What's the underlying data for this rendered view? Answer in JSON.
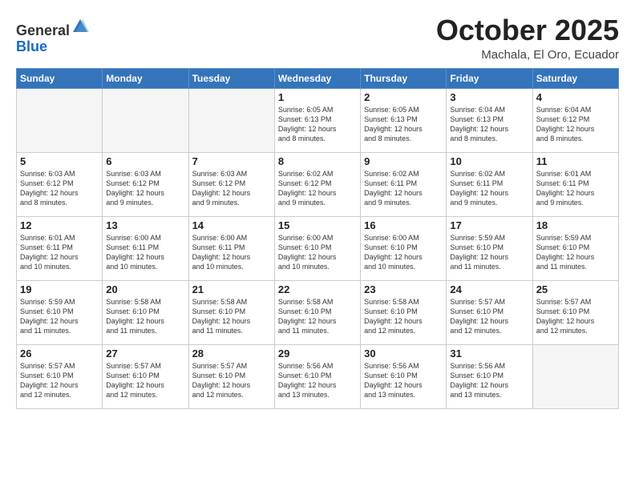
{
  "logo": {
    "general": "General",
    "blue": "Blue"
  },
  "header": {
    "title": "October 2025",
    "location": "Machala, El Oro, Ecuador"
  },
  "weekdays": [
    "Sunday",
    "Monday",
    "Tuesday",
    "Wednesday",
    "Thursday",
    "Friday",
    "Saturday"
  ],
  "weeks": [
    [
      {
        "day": "",
        "text": ""
      },
      {
        "day": "",
        "text": ""
      },
      {
        "day": "",
        "text": ""
      },
      {
        "day": "1",
        "text": "Sunrise: 6:05 AM\nSunset: 6:13 PM\nDaylight: 12 hours\nand 8 minutes."
      },
      {
        "day": "2",
        "text": "Sunrise: 6:05 AM\nSunset: 6:13 PM\nDaylight: 12 hours\nand 8 minutes."
      },
      {
        "day": "3",
        "text": "Sunrise: 6:04 AM\nSunset: 6:13 PM\nDaylight: 12 hours\nand 8 minutes."
      },
      {
        "day": "4",
        "text": "Sunrise: 6:04 AM\nSunset: 6:12 PM\nDaylight: 12 hours\nand 8 minutes."
      }
    ],
    [
      {
        "day": "5",
        "text": "Sunrise: 6:03 AM\nSunset: 6:12 PM\nDaylight: 12 hours\nand 8 minutes."
      },
      {
        "day": "6",
        "text": "Sunrise: 6:03 AM\nSunset: 6:12 PM\nDaylight: 12 hours\nand 9 minutes."
      },
      {
        "day": "7",
        "text": "Sunrise: 6:03 AM\nSunset: 6:12 PM\nDaylight: 12 hours\nand 9 minutes."
      },
      {
        "day": "8",
        "text": "Sunrise: 6:02 AM\nSunset: 6:12 PM\nDaylight: 12 hours\nand 9 minutes."
      },
      {
        "day": "9",
        "text": "Sunrise: 6:02 AM\nSunset: 6:11 PM\nDaylight: 12 hours\nand 9 minutes."
      },
      {
        "day": "10",
        "text": "Sunrise: 6:02 AM\nSunset: 6:11 PM\nDaylight: 12 hours\nand 9 minutes."
      },
      {
        "day": "11",
        "text": "Sunrise: 6:01 AM\nSunset: 6:11 PM\nDaylight: 12 hours\nand 9 minutes."
      }
    ],
    [
      {
        "day": "12",
        "text": "Sunrise: 6:01 AM\nSunset: 6:11 PM\nDaylight: 12 hours\nand 10 minutes."
      },
      {
        "day": "13",
        "text": "Sunrise: 6:00 AM\nSunset: 6:11 PM\nDaylight: 12 hours\nand 10 minutes."
      },
      {
        "day": "14",
        "text": "Sunrise: 6:00 AM\nSunset: 6:11 PM\nDaylight: 12 hours\nand 10 minutes."
      },
      {
        "day": "15",
        "text": "Sunrise: 6:00 AM\nSunset: 6:10 PM\nDaylight: 12 hours\nand 10 minutes."
      },
      {
        "day": "16",
        "text": "Sunrise: 6:00 AM\nSunset: 6:10 PM\nDaylight: 12 hours\nand 10 minutes."
      },
      {
        "day": "17",
        "text": "Sunrise: 5:59 AM\nSunset: 6:10 PM\nDaylight: 12 hours\nand 11 minutes."
      },
      {
        "day": "18",
        "text": "Sunrise: 5:59 AM\nSunset: 6:10 PM\nDaylight: 12 hours\nand 11 minutes."
      }
    ],
    [
      {
        "day": "19",
        "text": "Sunrise: 5:59 AM\nSunset: 6:10 PM\nDaylight: 12 hours\nand 11 minutes."
      },
      {
        "day": "20",
        "text": "Sunrise: 5:58 AM\nSunset: 6:10 PM\nDaylight: 12 hours\nand 11 minutes."
      },
      {
        "day": "21",
        "text": "Sunrise: 5:58 AM\nSunset: 6:10 PM\nDaylight: 12 hours\nand 11 minutes."
      },
      {
        "day": "22",
        "text": "Sunrise: 5:58 AM\nSunset: 6:10 PM\nDaylight: 12 hours\nand 11 minutes."
      },
      {
        "day": "23",
        "text": "Sunrise: 5:58 AM\nSunset: 6:10 PM\nDaylight: 12 hours\nand 12 minutes."
      },
      {
        "day": "24",
        "text": "Sunrise: 5:57 AM\nSunset: 6:10 PM\nDaylight: 12 hours\nand 12 minutes."
      },
      {
        "day": "25",
        "text": "Sunrise: 5:57 AM\nSunset: 6:10 PM\nDaylight: 12 hours\nand 12 minutes."
      }
    ],
    [
      {
        "day": "26",
        "text": "Sunrise: 5:57 AM\nSunset: 6:10 PM\nDaylight: 12 hours\nand 12 minutes."
      },
      {
        "day": "27",
        "text": "Sunrise: 5:57 AM\nSunset: 6:10 PM\nDaylight: 12 hours\nand 12 minutes."
      },
      {
        "day": "28",
        "text": "Sunrise: 5:57 AM\nSunset: 6:10 PM\nDaylight: 12 hours\nand 12 minutes."
      },
      {
        "day": "29",
        "text": "Sunrise: 5:56 AM\nSunset: 6:10 PM\nDaylight: 12 hours\nand 13 minutes."
      },
      {
        "day": "30",
        "text": "Sunrise: 5:56 AM\nSunset: 6:10 PM\nDaylight: 12 hours\nand 13 minutes."
      },
      {
        "day": "31",
        "text": "Sunrise: 5:56 AM\nSunset: 6:10 PM\nDaylight: 12 hours\nand 13 minutes."
      },
      {
        "day": "",
        "text": ""
      }
    ]
  ]
}
